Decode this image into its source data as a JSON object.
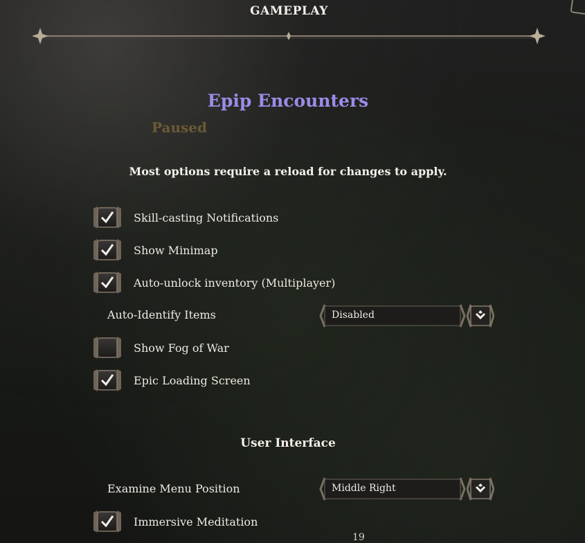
{
  "header": {
    "title": "GAMEPLAY"
  },
  "mod": {
    "title": "Epip Encounters",
    "status": "Paused",
    "notice": "Most options require a reload for changes to apply."
  },
  "options": [
    {
      "label": "Skill-casting Notifications",
      "checked": true
    },
    {
      "label": "Show Minimap",
      "checked": true
    },
    {
      "label": "Auto-unlock inventory (Multiplayer)",
      "checked": true
    },
    {
      "label": "Auto-Identify Items",
      "value": "Disabled"
    },
    {
      "label": "Show Fog of War",
      "checked": false
    },
    {
      "label": "Epic Loading Screen",
      "checked": true
    }
  ],
  "section_ui": {
    "title": "User Interface",
    "examine": {
      "label": "Examine Menu Position",
      "value": "Middle Right"
    },
    "meditation": {
      "label": "Immersive Meditation",
      "checked": true
    }
  },
  "footer": {
    "page_number": "19"
  },
  "colors": {
    "mod_title": "#9b8ce8",
    "status": "#6b5a36",
    "ornament": "#8b8070"
  }
}
